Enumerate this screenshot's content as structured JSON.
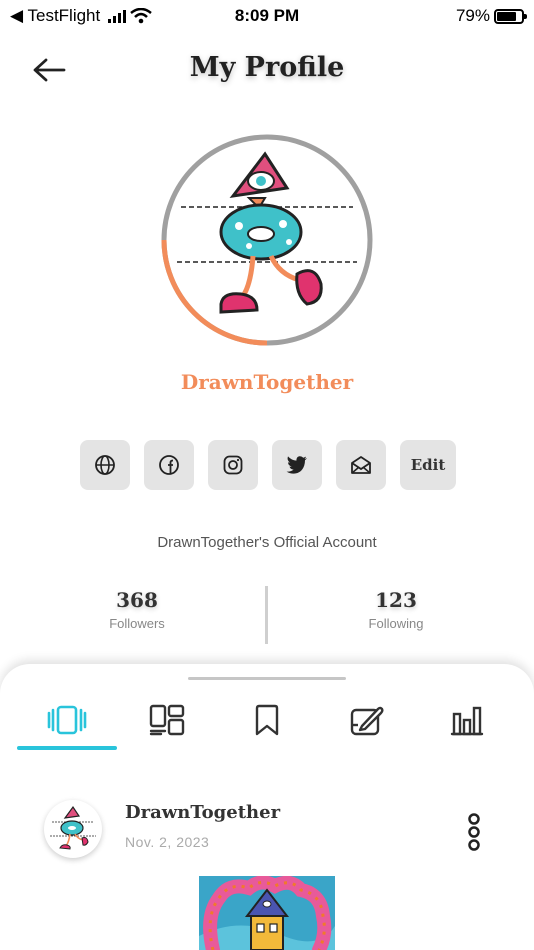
{
  "status_bar": {
    "back_app": "◀ TestFlight",
    "time": "8:09 PM",
    "battery": "79%"
  },
  "header": {
    "title": "My Profile"
  },
  "profile": {
    "username": "DrawnTogether",
    "bio": "DrawnTogether's Official Account",
    "progress_ring_fraction": 0.25,
    "colors": {
      "accent": "#f28c5a",
      "ring_gray": "#a0a0a0",
      "tab_active": "#29c4db"
    }
  },
  "actions": {
    "icons": [
      "globe-icon",
      "facebook-icon",
      "instagram-icon",
      "twitter-icon",
      "mail-icon"
    ],
    "edit_label": "Edit"
  },
  "stats": {
    "followers_count": "368",
    "followers_label": "Followers",
    "following_count": "123",
    "following_label": "Following"
  },
  "tabs": {
    "icons": [
      "posts-carousel-icon",
      "grid-layout-icon",
      "bookmark-icon",
      "edit-board-icon",
      "bar-chart-icon"
    ],
    "active_index": 0
  },
  "post": {
    "author": "DrawnTogether",
    "date": "Nov. 2, 2023"
  }
}
